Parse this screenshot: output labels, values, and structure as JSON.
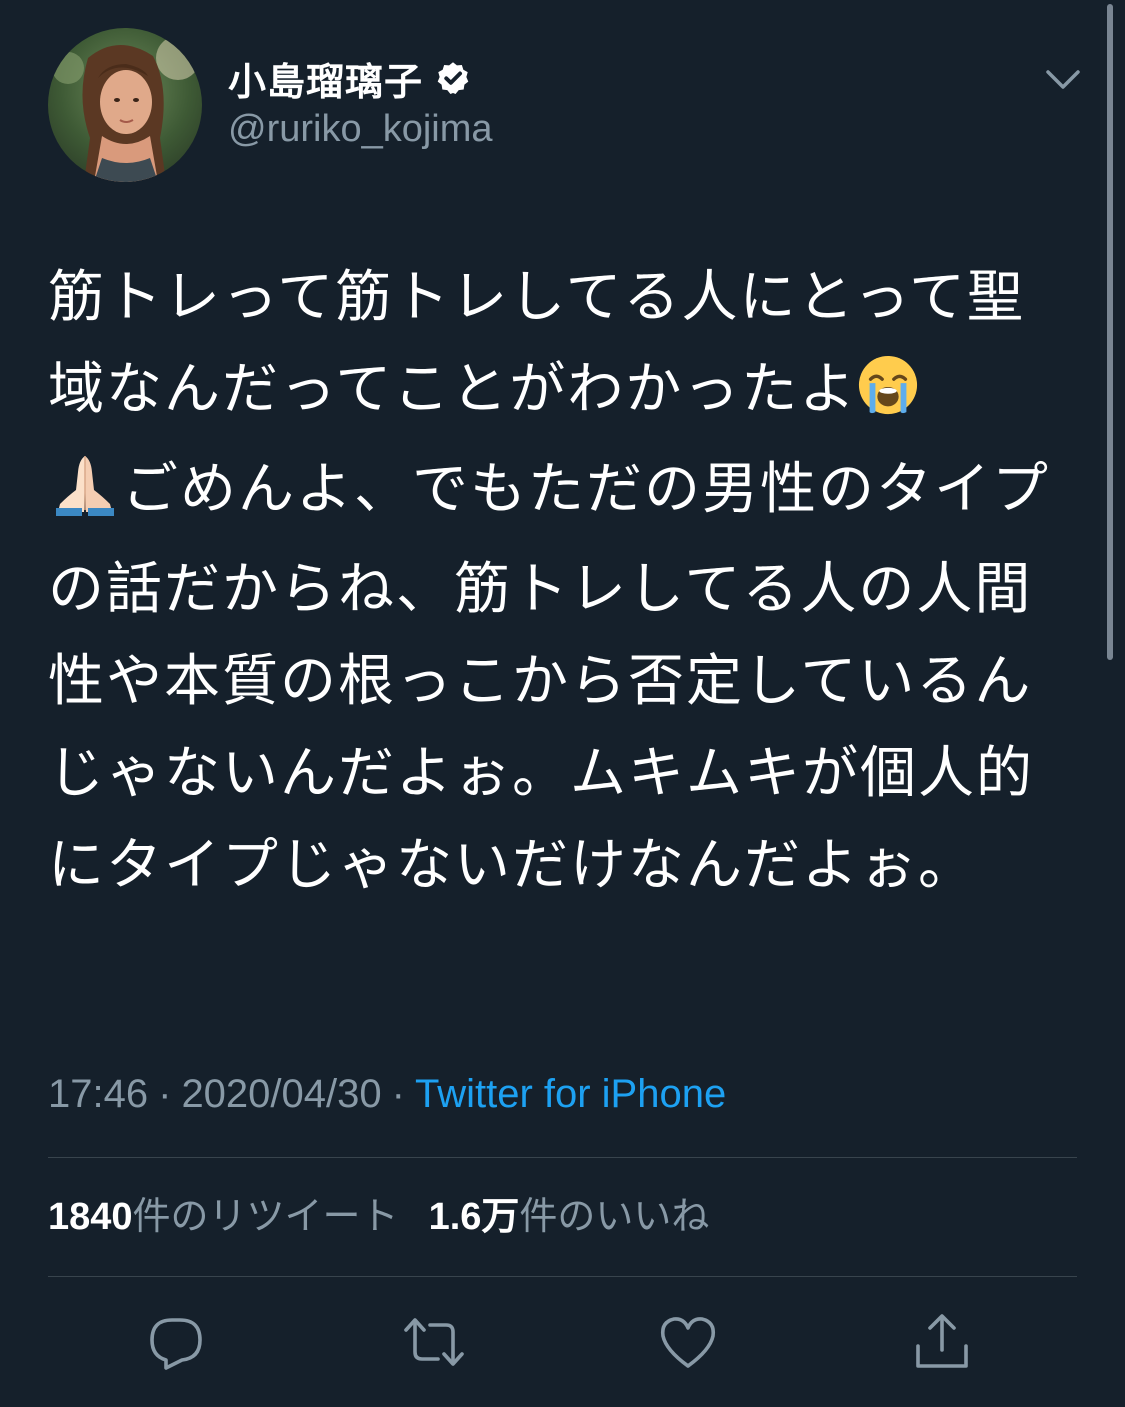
{
  "colors": {
    "background": "#15202b",
    "primary_text": "#ffffff",
    "secondary_text": "#8899a6",
    "accent": "#1da1f2",
    "divider": "#38444d"
  },
  "author": {
    "display_name": "小島瑠璃子",
    "handle": "@ruriko_kojima",
    "verified": true,
    "avatar_icon": "profile-photo",
    "verified_icon": "verified-badge-icon"
  },
  "tweet": {
    "text_part1": "筋トレって筋トレしてる人にとって聖域なんだってことがわかったよ",
    "emoji1": "loudly-crying-face-icon",
    "emoji2": "folded-hands-icon",
    "text_part2": "ごめんよ、でもただの男性のタイプの話だからね、筋トレしてる人の人間性や本質の根っこから否定しているんじゃないんだよぉ。ムキムキが個人的にタイプじゃないだけなんだよぉ。"
  },
  "meta": {
    "time": "17:46",
    "separator": "·",
    "date": "2020/04/30",
    "source": "Twitter for iPhone"
  },
  "stats": {
    "retweets_count": "1840",
    "retweets_label": "件のリツイート",
    "likes_count": "1.6万",
    "likes_label": "件のいいね"
  },
  "actions": {
    "reply_icon": "reply-icon",
    "retweet_icon": "retweet-icon",
    "like_icon": "heart-icon",
    "share_icon": "share-icon",
    "menu_icon": "chevron-down-icon"
  }
}
